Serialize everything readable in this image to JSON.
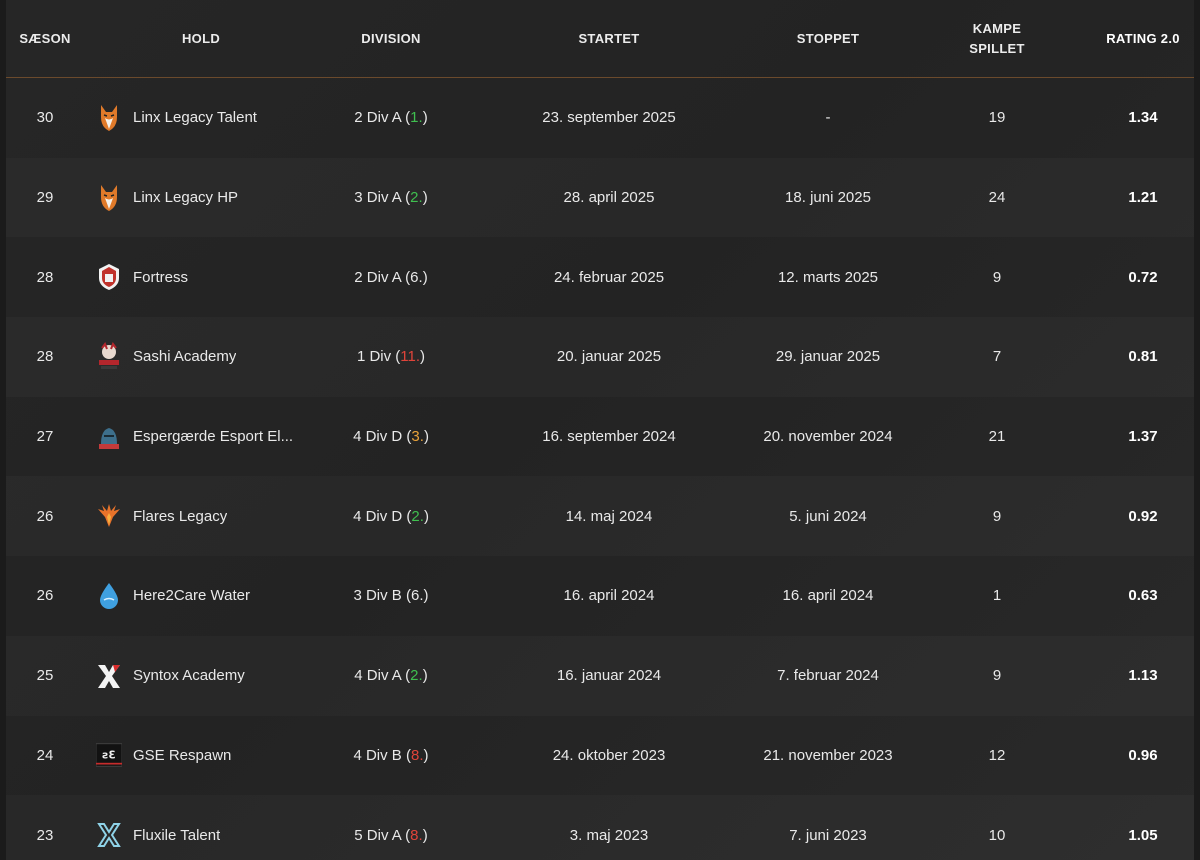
{
  "header": {
    "season": "SÆSON",
    "team": "HOLD",
    "division": "DIVISION",
    "started": "STARTET",
    "stopped": "STOPPET",
    "games_line1": "KAMPE",
    "games_line2": "SPILLET",
    "rating": "RATING 2.0"
  },
  "colors": {
    "green": "#3fbf4f",
    "orange": "#e8a23a",
    "red": "#e0443a",
    "neutral": "#e9e9e9"
  },
  "rows": [
    {
      "season": "30",
      "team": "Linx Legacy Talent",
      "icon": "fox-logo-icon",
      "division": "2 Div A",
      "pos": "1.",
      "pos_color": "#3fbf4f",
      "started": "23. september 2025",
      "stopped": "-",
      "games": "19",
      "rating": "1.34"
    },
    {
      "season": "29",
      "team": "Linx Legacy HP",
      "icon": "fox-logo-icon",
      "division": "3 Div A",
      "pos": "2.",
      "pos_color": "#3fbf4f",
      "started": "28. april 2025",
      "stopped": "18. juni 2025",
      "games": "24",
      "rating": "1.21"
    },
    {
      "season": "28",
      "team": "Fortress",
      "icon": "fortress-logo-icon",
      "division": "2 Div A",
      "pos": "6.",
      "pos_color": "#e9e9e9",
      "started": "24. februar 2025",
      "stopped": "12. marts 2025",
      "games": "9",
      "rating": "0.72"
    },
    {
      "season": "28",
      "team": "Sashi Academy",
      "icon": "sashi-logo-icon",
      "division": "1 Div",
      "pos": "11.",
      "pos_color": "#e0443a",
      "started": "20. januar 2025",
      "stopped": "29. januar 2025",
      "games": "7",
      "rating": "0.81"
    },
    {
      "season": "27",
      "team": "Espergærde Esport El...",
      "icon": "espergaerde-logo-icon",
      "division": "4 Div D",
      "pos": "3.",
      "pos_color": "#e8a23a",
      "started": "16. september 2024",
      "stopped": "20. november 2024",
      "games": "21",
      "rating": "1.37"
    },
    {
      "season": "26",
      "team": "Flares Legacy",
      "icon": "phoenix-logo-icon",
      "division": "4 Div D",
      "pos": "2.",
      "pos_color": "#3fbf4f",
      "started": "14. maj 2024",
      "stopped": "5. juni 2024",
      "games": "9",
      "rating": "0.92"
    },
    {
      "season": "26",
      "team": "Here2Care Water",
      "icon": "water-drop-logo-icon",
      "division": "3 Div B",
      "pos": "6.",
      "pos_color": "#e9e9e9",
      "started": "16. april 2024",
      "stopped": "16. april 2024",
      "games": "1",
      "rating": "0.63"
    },
    {
      "season": "25",
      "team": "Syntox Academy",
      "icon": "syntox-x-logo-icon",
      "division": "4 Div A",
      "pos": "2.",
      "pos_color": "#3fbf4f",
      "started": "16. januar 2024",
      "stopped": "7. februar 2024",
      "games": "9",
      "rating": "1.13"
    },
    {
      "season": "24",
      "team": "GSE Respawn",
      "icon": "gse-logo-icon",
      "division": "4 Div B",
      "pos": "8.",
      "pos_color": "#e0443a",
      "started": "24. oktober 2023",
      "stopped": "21. november 2023",
      "games": "12",
      "rating": "0.96"
    },
    {
      "season": "23",
      "team": "Fluxile Talent",
      "icon": "fluxile-logo-icon",
      "division": "5 Div A",
      "pos": "8.",
      "pos_color": "#e0443a",
      "started": "3. maj 2023",
      "stopped": "7. juni 2023",
      "games": "10",
      "rating": "1.05"
    }
  ]
}
